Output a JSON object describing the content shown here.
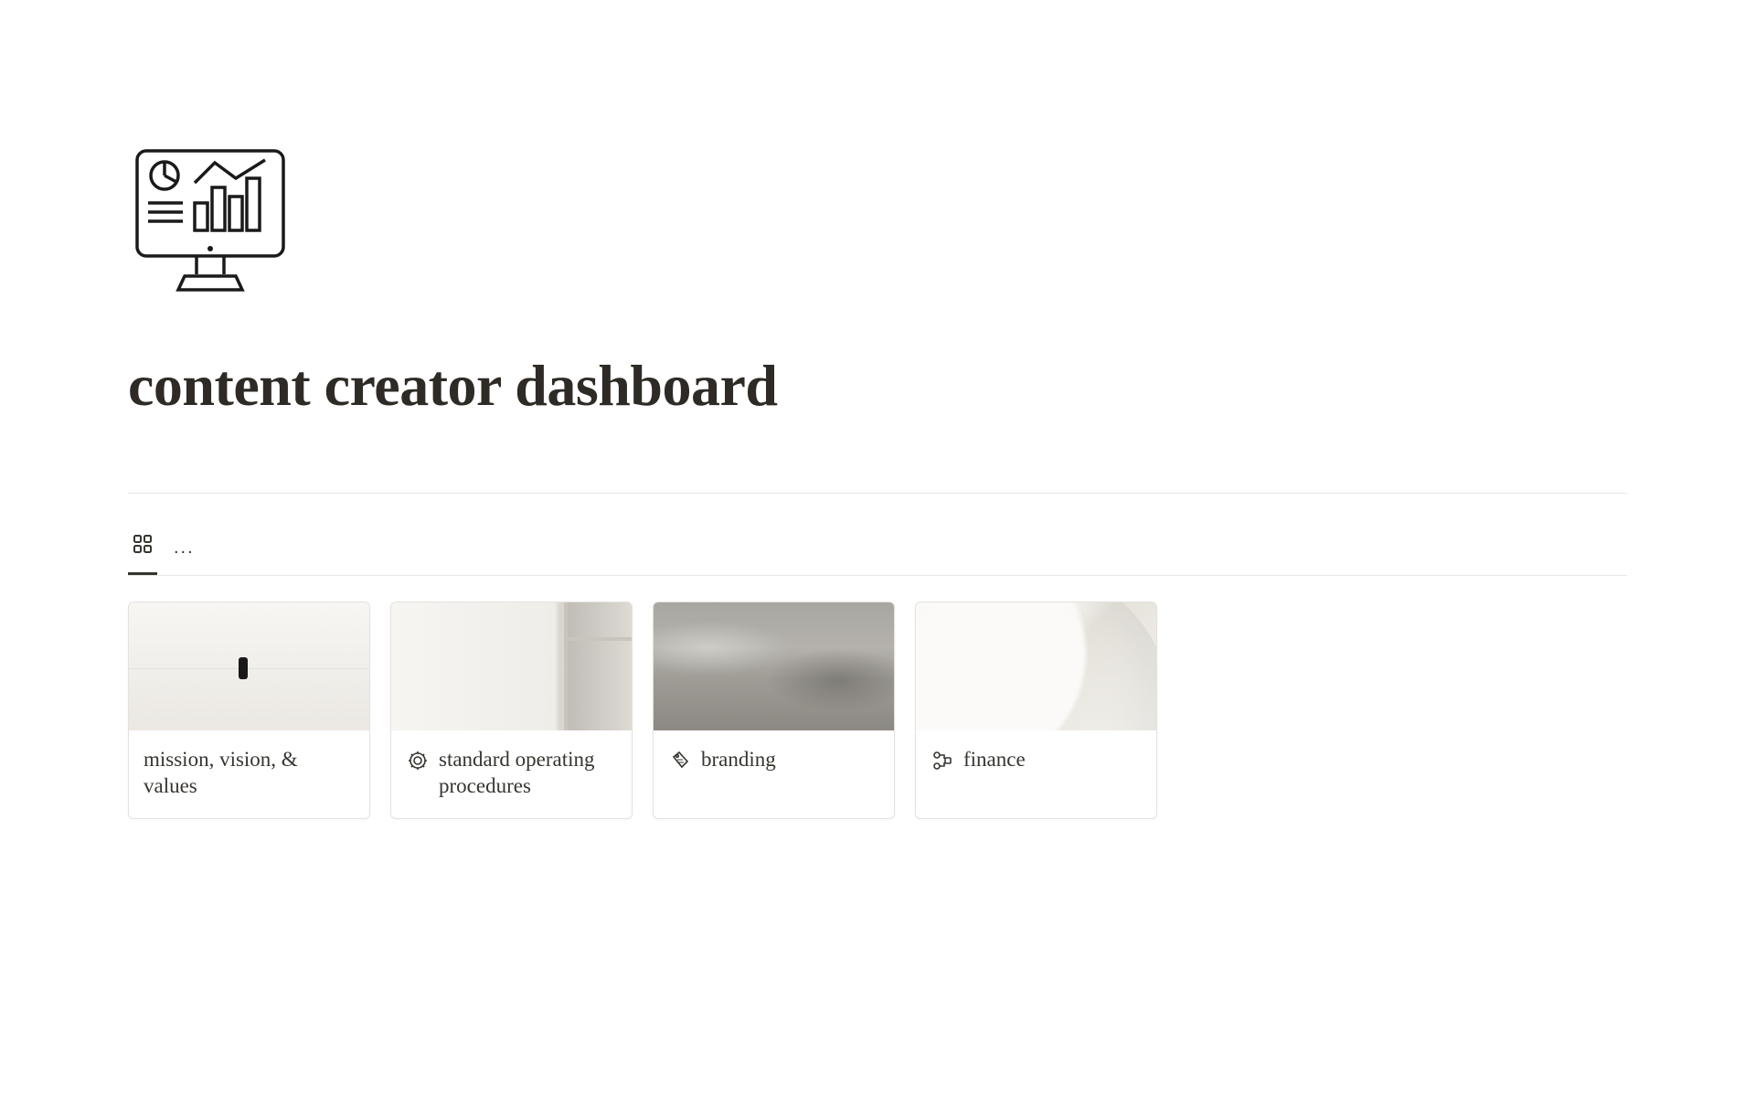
{
  "page": {
    "title": "content creator dashboard",
    "iconName": "dashboard-monitor-icon"
  },
  "views": {
    "activeTabIcon": "gallery-view-icon",
    "moreLabel": "..."
  },
  "cards": [
    {
      "title": "mission, vision, & values",
      "iconName": null,
      "coverName": "person-walking-minimal"
    },
    {
      "title": "standard operating procedures",
      "iconName": "sop-gear-icon",
      "coverName": "white-room-window"
    },
    {
      "title": "branding",
      "iconName": "brand-tag-icon",
      "coverName": "grey-clouds"
    },
    {
      "title": "finance",
      "iconName": "finance-flow-icon",
      "coverName": "abstract-white-curve"
    }
  ]
}
